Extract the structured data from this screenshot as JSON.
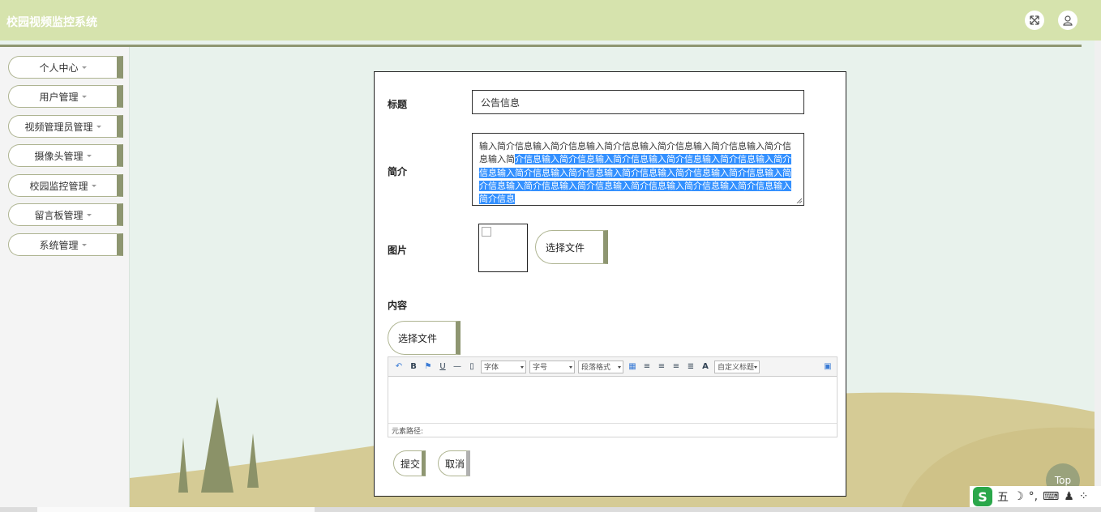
{
  "header": {
    "title": "校园视频监控系统"
  },
  "sidebar": {
    "items": [
      {
        "label": "个人中心"
      },
      {
        "label": "用户管理"
      },
      {
        "label": "视频管理员管理"
      },
      {
        "label": "摄像头管理"
      },
      {
        "label": "校园监控管理"
      },
      {
        "label": "留言板管理"
      },
      {
        "label": "系统管理"
      }
    ]
  },
  "form": {
    "title_label": "标题",
    "title_value": "公告信息",
    "summary_label": "简介",
    "summary_text_plain": "输入简介信息输入简介信息输入简介信息输入简介信息输入简介信息输入简介信息输入简",
    "summary_text_selected": "介信息输入简介信息输入简介信息输入简介信息输入简介信息输入简介信息输入简介信息输入简介信息输入简介信息输入简介信息输入简介信息输入简介信息输入简介信息输入简介信息输入简介信息输入简介信息输入简介信息输入简介信息",
    "image_label": "图片",
    "image_file_button": "选择文件",
    "content_label": "内容",
    "content_file_button": "选择文件",
    "editor": {
      "font_select": "字体",
      "size_select": "字号",
      "para_select": "段落格式",
      "custom_select": "自定义标题",
      "path_label": "元素路径:"
    },
    "submit_label": "提交",
    "cancel_label": "取消"
  },
  "top_button": "Top",
  "ime": {
    "logo": "S",
    "mode": "五"
  },
  "colors": {
    "header_bg": "#d6e3ad",
    "accent": "#8e9671",
    "selection": "#3390ff"
  }
}
